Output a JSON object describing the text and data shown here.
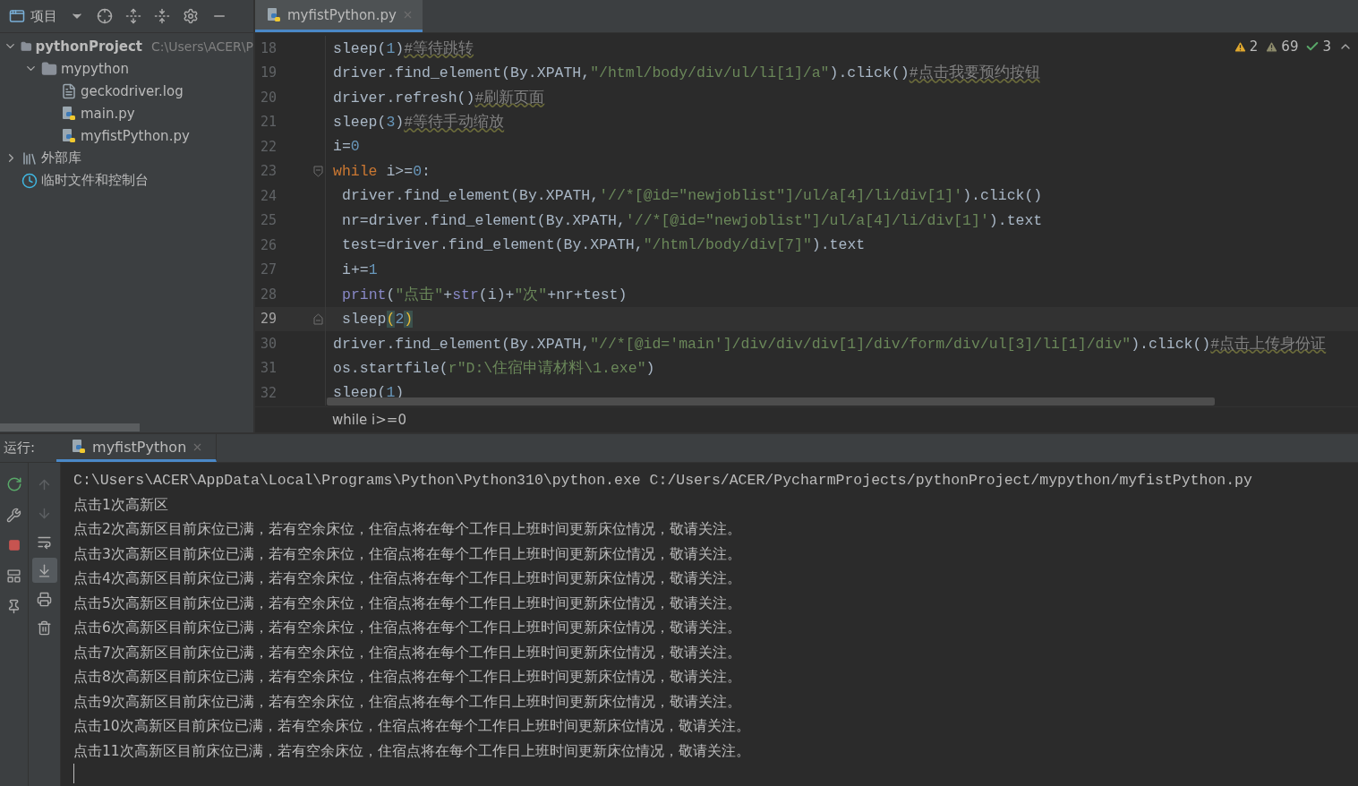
{
  "project_toolbar": {
    "title": "项目"
  },
  "project_tree": [
    {
      "name": "pythonProject",
      "path": "C:\\Users\\ACER\\P",
      "kind": "folder",
      "expanded": true,
      "children": [
        {
          "name": "mypython",
          "kind": "folder",
          "expanded": true,
          "children": [
            {
              "name": "geckodriver.log",
              "kind": "log"
            },
            {
              "name": "main.py",
              "kind": "python"
            },
            {
              "name": "myfistPython.py",
              "kind": "python"
            }
          ]
        }
      ]
    },
    {
      "name": "外部库",
      "kind": "library",
      "expanded": false
    },
    {
      "name": "临时文件和控制台",
      "kind": "scratch"
    }
  ],
  "editor_tabs": [
    {
      "label": "myfistPython.py",
      "selected": true
    }
  ],
  "inspections": [
    {
      "kind": "warning",
      "count": "2"
    },
    {
      "kind": "weak",
      "count": "69"
    },
    {
      "kind": "typo",
      "count": "3"
    }
  ],
  "code_lines": [
    {
      "number": "18",
      "indented": false,
      "current": false,
      "tokens": [
        {
          "kind": "plain",
          "text": "sleep("
        },
        {
          "kind": "number",
          "text": "1"
        },
        {
          "kind": "plain",
          "text": ")"
        },
        {
          "kind": "comment",
          "text": "#等待跳转"
        }
      ]
    },
    {
      "number": "19",
      "indented": false,
      "current": false,
      "tokens": [
        {
          "kind": "plain",
          "text": "driver.find_element(By.XPATH,"
        },
        {
          "kind": "string",
          "text": "\"/html/body/div/ul/li[1]/a\""
        },
        {
          "kind": "plain",
          "text": ").click()"
        },
        {
          "kind": "comment",
          "text": "#点击我要预约按钮"
        }
      ]
    },
    {
      "number": "20",
      "indented": false,
      "current": false,
      "tokens": [
        {
          "kind": "plain",
          "text": "driver.refresh()"
        },
        {
          "kind": "comment",
          "text": "#刷新页面"
        }
      ]
    },
    {
      "number": "21",
      "indented": false,
      "current": false,
      "tokens": [
        {
          "kind": "plain",
          "text": "sleep("
        },
        {
          "kind": "number",
          "text": "3"
        },
        {
          "kind": "plain",
          "text": ")"
        },
        {
          "kind": "comment",
          "text": "#等待手动缩放"
        }
      ]
    },
    {
      "number": "22",
      "indented": false,
      "current": false,
      "tokens": [
        {
          "kind": "plain",
          "text": "i="
        },
        {
          "kind": "number",
          "text": "0"
        }
      ]
    },
    {
      "number": "23",
      "indented": false,
      "current": false,
      "fold_start": true,
      "tokens": [
        {
          "kind": "keyword",
          "text": "while"
        },
        {
          "kind": "plain",
          "text": " i>="
        },
        {
          "kind": "number",
          "text": "0"
        },
        {
          "kind": "plain",
          "text": ":"
        }
      ]
    },
    {
      "number": "24",
      "indented": true,
      "current": false,
      "tokens": [
        {
          "kind": "plain",
          "text": "driver.find_element(By.XPATH,"
        },
        {
          "kind": "string",
          "text": "'//*[@id=\"newjoblist\"]/ul/a[4]/li/div[1]'"
        },
        {
          "kind": "plain",
          "text": ").click()"
        }
      ]
    },
    {
      "number": "25",
      "indented": true,
      "current": false,
      "tokens": [
        {
          "kind": "plain",
          "text": "nr=driver.find_element(By.XPATH,"
        },
        {
          "kind": "string",
          "text": "'//*[@id=\"newjoblist\"]/ul/a[4]/li/div[1]'"
        },
        {
          "kind": "plain",
          "text": ").text"
        }
      ]
    },
    {
      "number": "26",
      "indented": true,
      "current": false,
      "tokens": [
        {
          "kind": "plain",
          "text": "test=driver.find_element(By.XPATH,"
        },
        {
          "kind": "string",
          "text": "\"/html/body/div[7]\""
        },
        {
          "kind": "plain",
          "text": ").text"
        }
      ]
    },
    {
      "number": "27",
      "indented": true,
      "current": false,
      "tokens": [
        {
          "kind": "plain",
          "text": "i+="
        },
        {
          "kind": "number",
          "text": "1"
        }
      ]
    },
    {
      "number": "28",
      "indented": true,
      "current": false,
      "tokens": [
        {
          "kind": "builtin",
          "text": "print"
        },
        {
          "kind": "plain",
          "text": "("
        },
        {
          "kind": "string",
          "text": "\"点击\""
        },
        {
          "kind": "plain",
          "text": "+"
        },
        {
          "kind": "builtin",
          "text": "str"
        },
        {
          "kind": "plain",
          "text": "(i)+"
        },
        {
          "kind": "string",
          "text": "\"次\""
        },
        {
          "kind": "plain",
          "text": "+nr+test)"
        }
      ]
    },
    {
      "number": "29",
      "indented": true,
      "current": true,
      "fold_end": true,
      "tokens": [
        {
          "kind": "plain",
          "text": "sleep"
        },
        {
          "kind": "brace",
          "text": "("
        },
        {
          "kind": "number",
          "text": "2"
        },
        {
          "kind": "brace",
          "text": ")"
        }
      ]
    },
    {
      "number": "30",
      "indented": false,
      "current": false,
      "tokens": [
        {
          "kind": "plain",
          "text": "driver.find_element(By.XPATH,"
        },
        {
          "kind": "string",
          "text": "\"//*[@id='main']/div/div/div[1]/div/form/div/ul[3]/li[1]/div\""
        },
        {
          "kind": "plain",
          "text": ").click()"
        },
        {
          "kind": "comment",
          "text": "#点击上传身份证"
        }
      ]
    },
    {
      "number": "31",
      "indented": false,
      "current": false,
      "tokens": [
        {
          "kind": "plain",
          "text": "os.startfile("
        },
        {
          "kind": "string",
          "text": "r\"D:\\住宿申请材料\\1.exe\""
        },
        {
          "kind": "plain",
          "text": ")"
        }
      ]
    },
    {
      "number": "32",
      "indented": false,
      "current": false,
      "tokens": [
        {
          "kind": "plain",
          "text": "sleep("
        },
        {
          "kind": "number",
          "text": "1"
        },
        {
          "kind": "plain",
          "text": ")"
        }
      ]
    }
  ],
  "breadcrumb": "while i>=0",
  "run_panel": {
    "label": "运行:",
    "tabs": [
      {
        "label": "myfistPython",
        "selected": true
      }
    ],
    "console": [
      {
        "kind": "command",
        "text": "C:\\Users\\ACER\\AppData\\Local\\Programs\\Python\\Python310\\python.exe C:/Users/ACER/PycharmProjects/pythonProject/mypython/myfistPython.py"
      },
      {
        "kind": "output",
        "text": "点击1次高新区"
      },
      {
        "kind": "output",
        "text": "点击2次高新区目前床位已满，若有空余床位，住宿点将在每个工作日上班时间更新床位情况，敬请关注。"
      },
      {
        "kind": "output",
        "text": "点击3次高新区目前床位已满，若有空余床位，住宿点将在每个工作日上班时间更新床位情况，敬请关注。"
      },
      {
        "kind": "output",
        "text": "点击4次高新区目前床位已满，若有空余床位，住宿点将在每个工作日上班时间更新床位情况，敬请关注。"
      },
      {
        "kind": "output",
        "text": "点击5次高新区目前床位已满，若有空余床位，住宿点将在每个工作日上班时间更新床位情况，敬请关注。"
      },
      {
        "kind": "output",
        "text": "点击6次高新区目前床位已满，若有空余床位，住宿点将在每个工作日上班时间更新床位情况，敬请关注。"
      },
      {
        "kind": "output",
        "text": "点击7次高新区目前床位已满，若有空余床位，住宿点将在每个工作日上班时间更新床位情况，敬请关注。"
      },
      {
        "kind": "output",
        "text": "点击8次高新区目前床位已满，若有空余床位，住宿点将在每个工作日上班时间更新床位情况，敬请关注。"
      },
      {
        "kind": "output",
        "text": "点击9次高新区目前床位已满，若有空余床位，住宿点将在每个工作日上班时间更新床位情况，敬请关注。"
      },
      {
        "kind": "output",
        "text": "点击10次高新区目前床位已满，若有空余床位，住宿点将在每个工作日上班时间更新床位情况，敬请关注。"
      },
      {
        "kind": "output",
        "text": "点击11次高新区目前床位已满，若有空余床位，住宿点将在每个工作日上班时间更新床位情况，敬请关注。"
      }
    ]
  }
}
